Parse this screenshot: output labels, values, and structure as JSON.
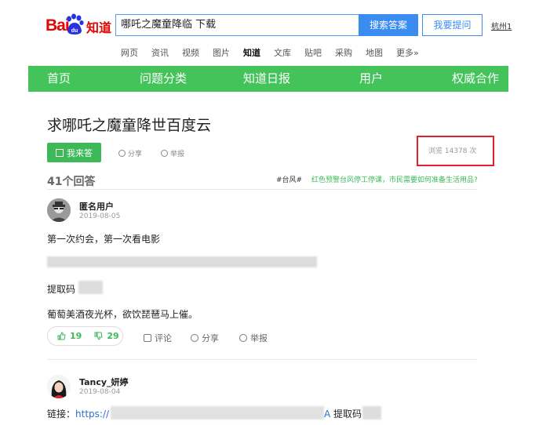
{
  "header": {
    "logo_text_bai": "Bai",
    "logo_text_du": "du",
    "logo_text_zhidao": "知道",
    "search_value": "哪吒之魔童降临 下载",
    "search_button": "搜索答案",
    "ask_button": "我要提问",
    "city": "杭州1"
  },
  "nav": {
    "items": [
      "网页",
      "资讯",
      "视频",
      "图片",
      "知道",
      "文库",
      "贴吧",
      "采购",
      "地图",
      "更多»"
    ],
    "active_index": 4
  },
  "greenbar": {
    "items": [
      "首页",
      "问题分类",
      "知道日报",
      "用户",
      "权威合作"
    ]
  },
  "question": {
    "title": "求哪吒之魔童降世百度云",
    "answer_button": "我来答",
    "share": "分享",
    "report": "举报",
    "views": "浏览 14378 次"
  },
  "answers": {
    "count": "41个回答",
    "hot_tag": "#台风#",
    "hot_link": "红色预警台风停工停课，市民需要如何准备生活用品?"
  },
  "answer1": {
    "user": "匿名用户",
    "date": "2019-08-05",
    "line1": "第一次约会，第一次看电影",
    "line2": "提取码",
    "line3": "葡萄美酒夜光杯，欲饮琵琶马上催。",
    "likes": "19",
    "dislikes": "29",
    "comment": "评论",
    "share": "分享",
    "report": "举报"
  },
  "answer2": {
    "user": "Tancy_妍婷",
    "date": "2019-08-04",
    "link_label": "链接：",
    "link_prefix": "https://",
    "link_suffix": "A",
    "code_label": "提取码"
  },
  "colors": {
    "brand_red": "#e10602",
    "brand_blue": "#3b8cf0",
    "green": "#43c35a",
    "highlight_red": "#e0222c"
  }
}
